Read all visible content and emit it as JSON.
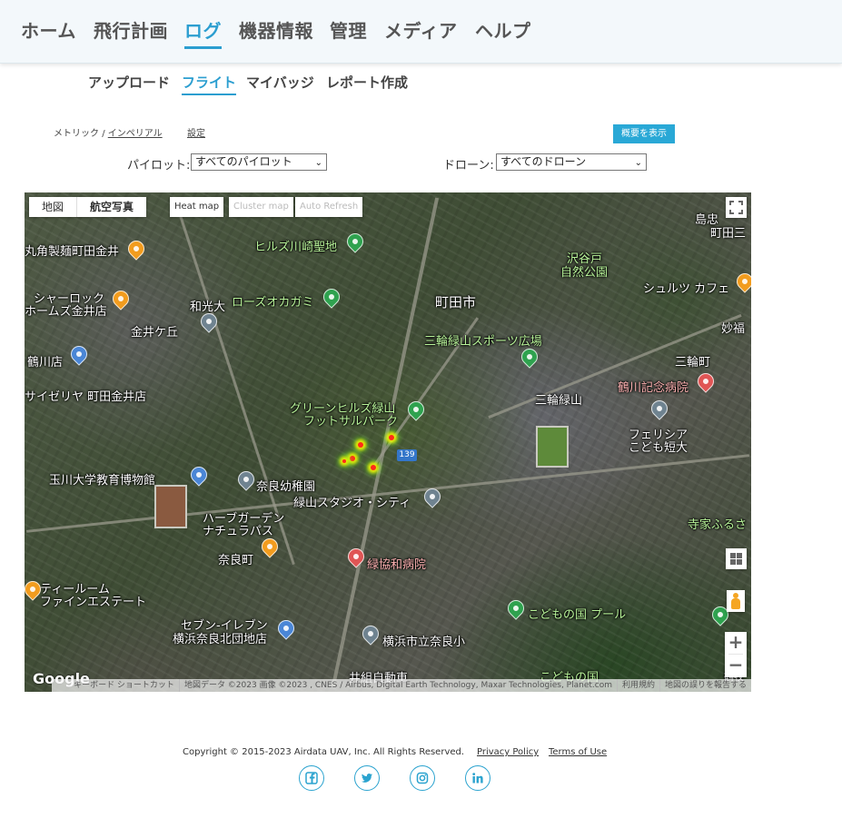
{
  "top_nav": {
    "items": [
      {
        "label": "ホーム"
      },
      {
        "label": "飛行計画"
      },
      {
        "label": "ログ"
      },
      {
        "label": "機器情報"
      },
      {
        "label": "管理"
      },
      {
        "label": "メディア"
      },
      {
        "label": "ヘルプ"
      }
    ],
    "active": "ログ"
  },
  "sub_nav": {
    "items": [
      {
        "label": "アップロード"
      },
      {
        "label": "フライト"
      },
      {
        "label": "マイバッジ"
      },
      {
        "label": "レポート作成"
      }
    ],
    "active": "フライト"
  },
  "toolbar": {
    "metric_label": "メトリック",
    "separator": "/",
    "imperial_label": "インペリアル",
    "settings_label": "設定",
    "summary_button": "概要を表示"
  },
  "filters": {
    "pilot_label": "パイロット:",
    "pilot_value": "すべてのパイロット",
    "drone_label": "ドローン:",
    "drone_value": "すべてのドローン"
  },
  "map": {
    "type_buttons": [
      {
        "label": "地図"
      },
      {
        "label": "航空写真"
      }
    ],
    "selected_type": "航空写真",
    "heat_map_label": "Heat map",
    "cluster_map_label": "Cluster map",
    "auto_refresh_label": "Auto Refresh",
    "zoom_in": "+",
    "zoom_out": "−",
    "google_logo": "Google",
    "route_number": "139",
    "places": {
      "hills_kawasaki": "ヒルズ川崎聖地",
      "marukaku": "丸角製麺町田金井",
      "sherlock_1": "シャーロック",
      "sherlock_2": "ホームズ金井店",
      "rose_okagami": "ローズオカガミ",
      "wakodai": "和光大",
      "kanaigaoka": "金井ケ丘",
      "tsurukawa_store": "鶴川店",
      "saizeriya": "サイゼリヤ 町田金井店",
      "machida_city": "町田市",
      "sawayato_1": "沢谷戸",
      "sawayato_2": "自然公園",
      "schultz_cafe": "シュルツ カフェ",
      "shimachu_1": "島忠",
      "shimachu_2": "町田三",
      "myoufuku": "妙福",
      "miwa_cho": "三輪町",
      "miwa_sports": "三輪緑山スポーツ広場",
      "tsurukawa_hospital": "鶴川記念病院",
      "miwa_ryokuzan": "三輪緑山",
      "green_hills_1": "グリーンヒルズ緑山",
      "green_hills_2": "フットサルパーク",
      "felicia_1": "フェリシア",
      "felicia_2": "こども短大",
      "tamagawa_museum": "玉川大学教育博物館",
      "nara_kindergarten": "奈良幼稚園",
      "ryokuzan_studio": "緑山スタジオ・シティ",
      "herb_garden_1": "ハーブガーデン",
      "herb_garden_2": "ナチュラパス",
      "terai": "寺家ふるさ",
      "naracho": "奈良町",
      "ryokkyo_hospital": "緑協和病院",
      "tearoom_1": "ティールーム",
      "tearoom_2": "ファインエステート",
      "kodomo_pool": "こどもの国 プール",
      "seven_eleven_1": "セブン-イレブン",
      "seven_eleven_2": "横浜奈良北団地店",
      "nara_elementary": "横浜市立奈良小",
      "kodomo_no_kuni": "こどもの国",
      "izumi_auto": "井組自動車",
      "tsurumaki": "鶴牧"
    },
    "attribution": {
      "shortcuts": "キーボード ショートカット",
      "data": "地図データ ©2023 画像 ©2023 , CNES / Airbus, Digital Earth Technology, Maxar Technologies, Planet.com",
      "terms": "利用規約",
      "report": "地図の誤りを報告する"
    },
    "icons": {
      "fullscreen": "fullscreen-icon",
      "layers": "grid-icon",
      "pegman": "pegman-icon"
    }
  },
  "footer": {
    "copyright": "Copyright © 2015-2023 Airdata UAV, Inc. All Rights Reserved.",
    "privacy_policy": "Privacy Policy",
    "terms_of_use": "Terms of Use",
    "social": [
      "facebook-icon",
      "twitter-icon",
      "instagram-icon",
      "linkedin-icon"
    ],
    "accent_color": "#2ba3cf"
  }
}
